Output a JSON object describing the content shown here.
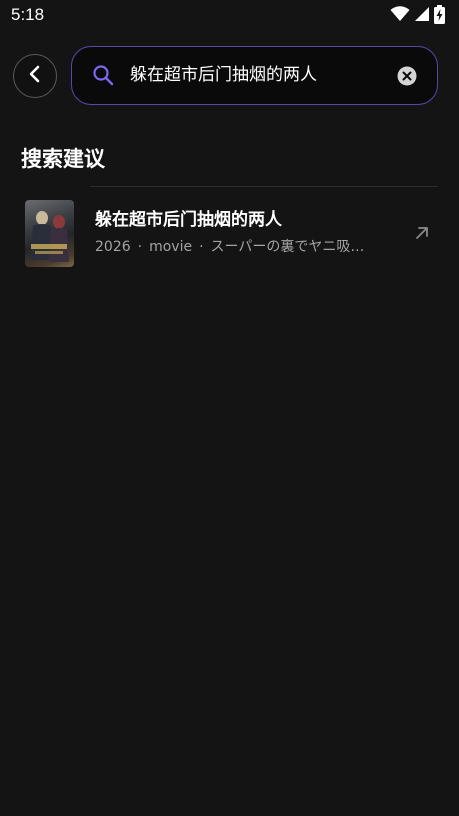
{
  "status_bar": {
    "time": "5:18"
  },
  "search": {
    "query": "躲在超市后门抽烟的两人"
  },
  "section": {
    "title": "搜索建议"
  },
  "suggestions": [
    {
      "title": "躲在超市后门抽烟的两人",
      "year": "2026",
      "type": "movie",
      "original_title": "スーパーの裏でヤニ吸…"
    }
  ],
  "colors": {
    "background": "#141414",
    "accent": "#7b68ee",
    "search_border": "#5a48a8",
    "muted_text": "#a3a3a3"
  },
  "icons": {
    "back": "chevron-left-icon",
    "search": "search-icon",
    "clear": "clear-icon",
    "open": "arrow-up-right-icon",
    "wifi": "wifi-icon",
    "signal": "signal-icon",
    "battery": "battery-charging-icon"
  }
}
